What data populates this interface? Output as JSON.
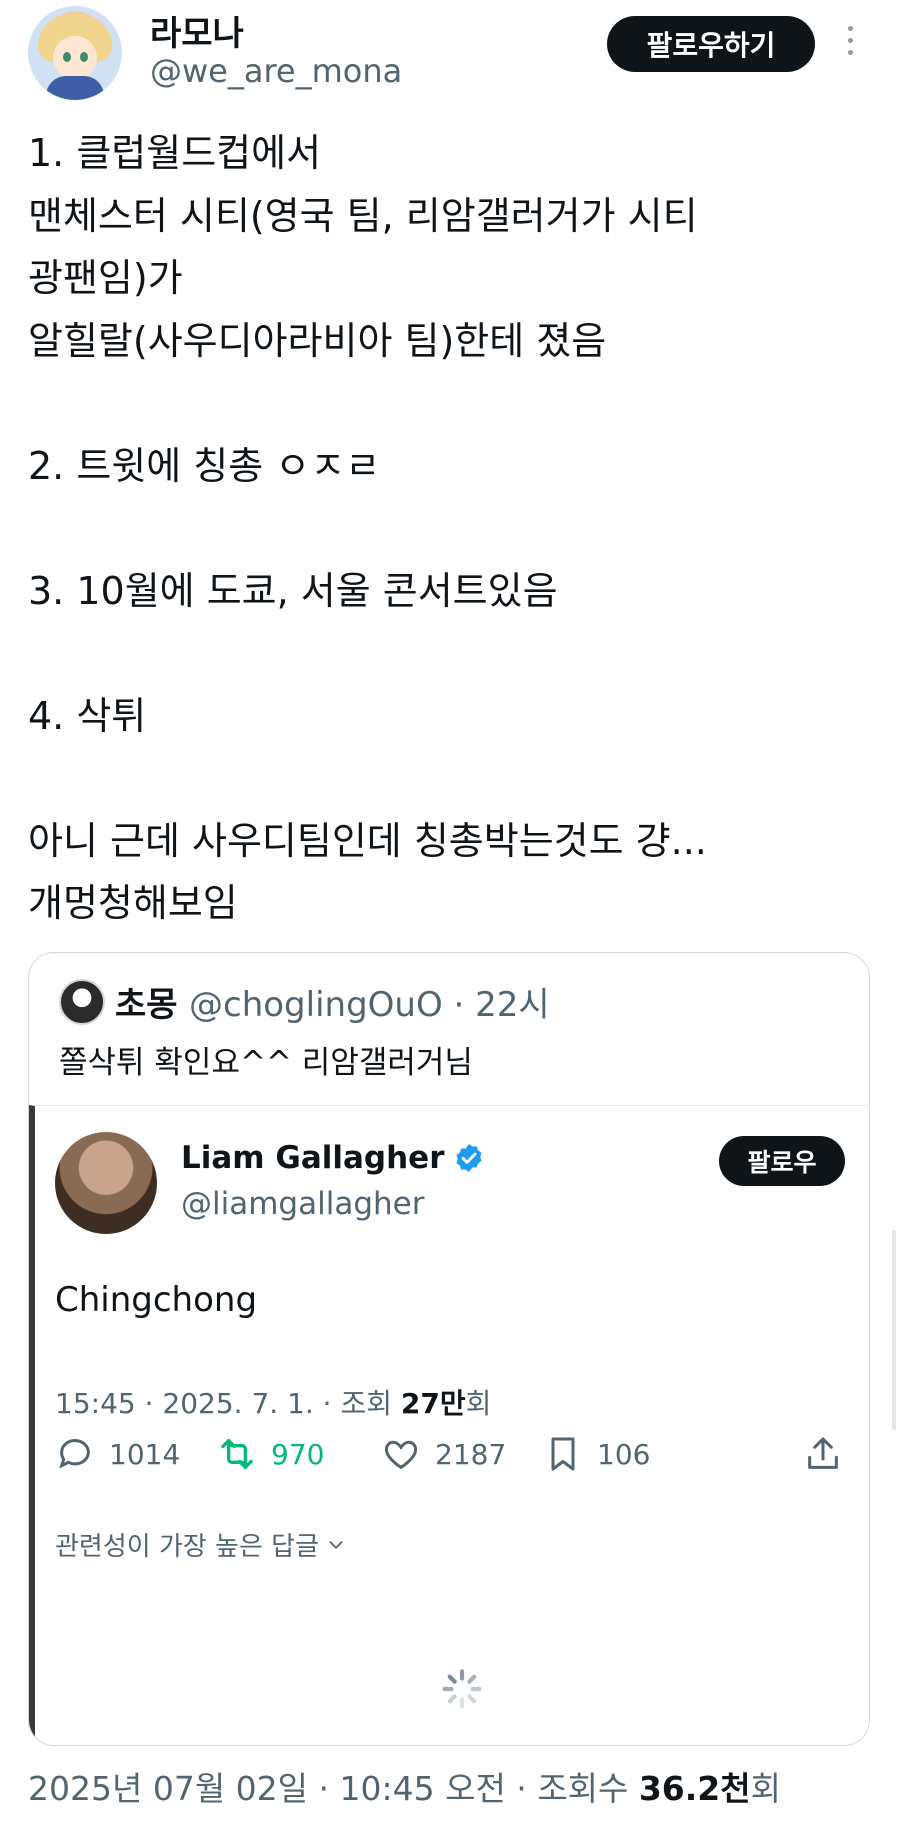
{
  "author": {
    "display_name": "라모나",
    "handle": "@we_are_mona",
    "follow_label": "팔로우하기"
  },
  "tweet": {
    "text": "1. 클럽월드컵에서\n맨체스터 시티(영국 팀, 리암갤러거가 시티\n광팬임)가\n알힐랄(사우디아라비아 팀)한테 졌음\n\n2. 트윗에 칭총 ㅇㅈㄹ\n\n3. 10월에 도쿄, 서울 콘서트있음\n\n4. 삭튀\n\n아니 근데 사우디팀인데 칭총박는것도 걍...\n개멍청해보임"
  },
  "quote": {
    "name": "초몽",
    "meta": "@choglingOuO · 22시",
    "text": "쫄삭튀 확인요^^ 리암갤러거님",
    "embedded": {
      "name": "Liam Gallagher",
      "handle": "@liamgallagher",
      "follow_label": "팔로우",
      "text": "Chingchong",
      "meta_prefix": "15:45 · 2025. 7. 1. · 조회 ",
      "views": "27만",
      "views_suffix": "회",
      "replies": "1014",
      "retweets": "970",
      "likes": "2187",
      "bookmarks": "106",
      "replies_toggle": "관련성이 가장 높은 답글",
      "retweet_color": "#00ba7c"
    }
  },
  "footer": {
    "prefix": "2025년 07월 02일 · 10:45 오전 · 조회수 ",
    "views": "36.2천",
    "suffix": "회"
  }
}
